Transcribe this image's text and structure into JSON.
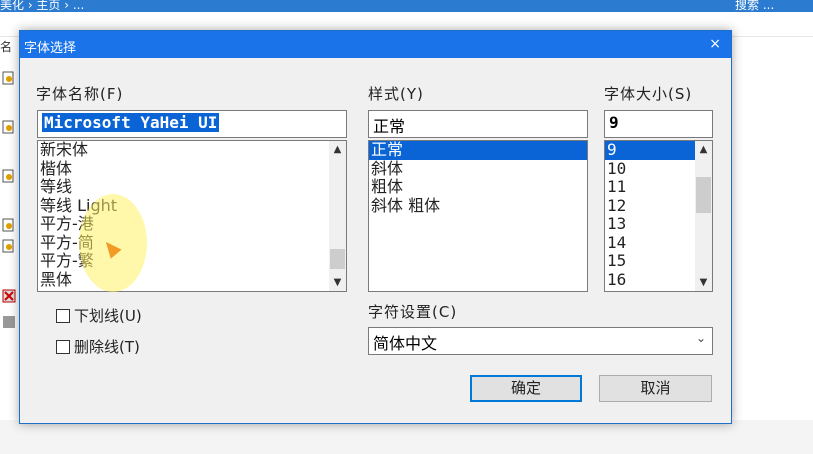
{
  "background": {
    "crumbs_left": "美化  ›  主页  ›  ...",
    "crumbs_right": "搜索 ...",
    "name_column_fragment": "名"
  },
  "dialog": {
    "title": "字体选择",
    "close_glyph": "×",
    "font_name": {
      "label": "字体名称(F)",
      "value": "Microsoft YaHei UI",
      "items": [
        {
          "text": "新宋体",
          "selected": false,
          "small": false
        },
        {
          "text": "楷体",
          "selected": false,
          "small": false
        },
        {
          "text": "等线",
          "selected": false,
          "small": false
        },
        {
          "text": "等线 Light",
          "selected": false,
          "small": false
        },
        {
          "text": "平方-港",
          "selected": false,
          "small": false
        },
        {
          "text": "平方-简",
          "selected": false,
          "small": false
        },
        {
          "text": "平方-繁",
          "selected": false,
          "small": false
        },
        {
          "text": "黑体",
          "selected": false,
          "small": false
        }
      ]
    },
    "style": {
      "label": "样式(Y)",
      "value": "正常",
      "items": [
        {
          "text": "正常",
          "selected": true
        },
        {
          "text": "斜体",
          "selected": false
        },
        {
          "text": "粗体",
          "selected": false
        },
        {
          "text": "斜体 粗体",
          "selected": false
        }
      ]
    },
    "size": {
      "label": "字体大小(S)",
      "value": "9",
      "items": [
        {
          "text": "9",
          "selected": true
        },
        {
          "text": "10",
          "selected": false
        },
        {
          "text": "11",
          "selected": false
        },
        {
          "text": "12",
          "selected": false
        },
        {
          "text": "13",
          "selected": false
        },
        {
          "text": "14",
          "selected": false
        },
        {
          "text": "15",
          "selected": false
        },
        {
          "text": "16",
          "selected": false
        }
      ]
    },
    "underline_label": "下划线(U)",
    "strikeout_label": "删除线(T)",
    "charset": {
      "label": "字符设置(C)",
      "value": "简体中文"
    },
    "ok_label": "确定",
    "cancel_label": "取消"
  },
  "colors": {
    "title_bar": "#1a73e8",
    "selection": "#0a64d6",
    "highlight_halo": "#fff064"
  }
}
